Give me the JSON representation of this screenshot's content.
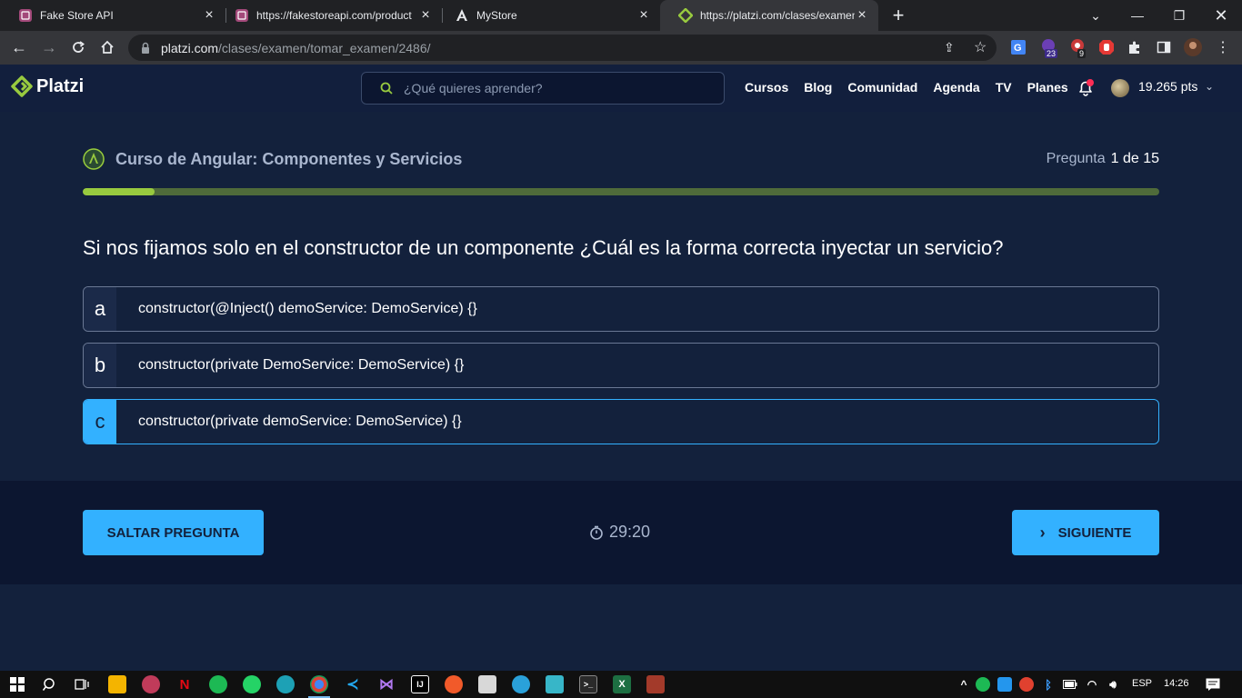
{
  "browser": {
    "tabs": [
      {
        "title": "Fake Store API"
      },
      {
        "title": "https://fakestoreapi.com/product"
      },
      {
        "title": "MyStore"
      },
      {
        "title": "https://platzi.com/clases/examen"
      }
    ],
    "url_host": "platzi.com",
    "url_path": "/clases/examen/tomar_examen/2486/",
    "ext_badges": {
      "b1": "23",
      "b2": "9"
    }
  },
  "header": {
    "logo": "Platzi",
    "search_placeholder": "¿Qué quieres aprender?",
    "nav": [
      "Cursos",
      "Blog",
      "Comunidad",
      "Agenda",
      "TV",
      "Planes"
    ],
    "points": "19.265 pts"
  },
  "exam": {
    "course_title": "Curso de Angular: Componentes y Servicios",
    "counter_label": "Pregunta",
    "counter_value": "1 de 15",
    "progress_fraction": 0.0667,
    "question": "Si nos fijamos solo en el constructor de un componente ¿Cuál es la forma correcta inyectar un servicio?",
    "options": [
      {
        "letter": "a",
        "text": "constructor(@Inject() demoService: DemoService) {}"
      },
      {
        "letter": "b",
        "text": "constructor(private DemoService: DemoService) {}"
      },
      {
        "letter": "c",
        "text": "constructor(private demoService: DemoService) {}"
      }
    ],
    "selected_option": "c"
  },
  "footer": {
    "skip_label": "SALTAR PREGUNTA",
    "timer": "29:20",
    "next_label": "SIGUIENTE"
  },
  "taskbar": {
    "lang": "ESP",
    "time": "14:26"
  },
  "colors": {
    "accent": "#33b1ff",
    "progress": "#98ca3f",
    "background": "#13213c"
  }
}
